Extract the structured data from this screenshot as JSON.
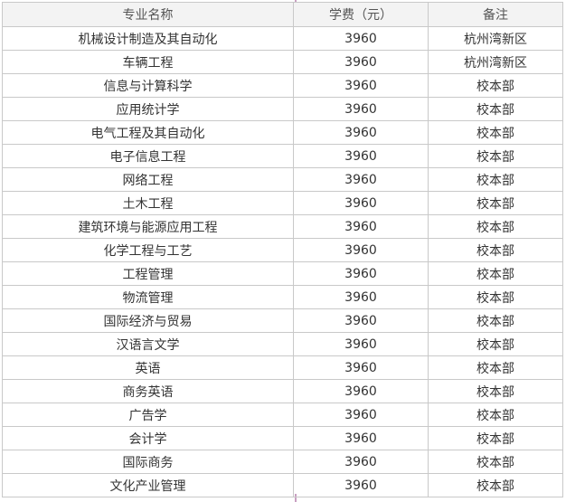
{
  "table": {
    "headers": [
      "专业名称",
      "学费（元）",
      "备注"
    ],
    "rows": [
      [
        "机械设计制造及其自动化",
        "3960",
        "杭州湾新区"
      ],
      [
        "车辆工程",
        "3960",
        "杭州湾新区"
      ],
      [
        "信息与计算科学",
        "3960",
        "校本部"
      ],
      [
        "应用统计学",
        "3960",
        "校本部"
      ],
      [
        "电气工程及其自动化",
        "3960",
        "校本部"
      ],
      [
        "电子信息工程",
        "3960",
        "校本部"
      ],
      [
        "网络工程",
        "3960",
        "校本部"
      ],
      [
        "土木工程",
        "3960",
        "校本部"
      ],
      [
        "建筑环境与能源应用工程",
        "3960",
        "校本部"
      ],
      [
        "化学工程与工艺",
        "3960",
        "校本部"
      ],
      [
        "工程管理",
        "3960",
        "校本部"
      ],
      [
        "物流管理",
        "3960",
        "校本部"
      ],
      [
        "国际经济与贸易",
        "3960",
        "校本部"
      ],
      [
        "汉语言文学",
        "3960",
        "校本部"
      ],
      [
        "英语",
        "3960",
        "校本部"
      ],
      [
        "商务英语",
        "3960",
        "校本部"
      ],
      [
        "广告学",
        "3960",
        "校本部"
      ],
      [
        "会计学",
        "3960",
        "校本部"
      ],
      [
        "国际商务",
        "3960",
        "校本部"
      ],
      [
        "文化产业管理",
        "3960",
        "校本部"
      ]
    ]
  }
}
